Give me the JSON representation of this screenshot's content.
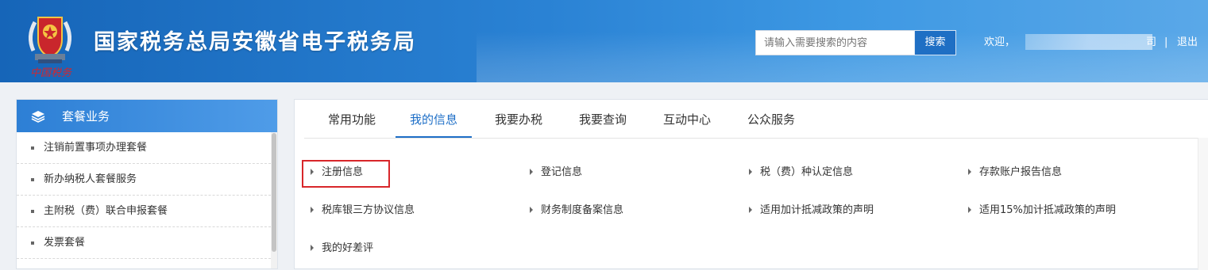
{
  "header": {
    "site_title": "国家税务总局安徽省电子税务局",
    "logo_text": "中国税务",
    "search_placeholder": "请输入需要搜索的内容",
    "search_button": "搜索",
    "welcome": "欢迎，",
    "company_tail": "司",
    "separator": "|",
    "logout": "退出"
  },
  "sidebar": {
    "title": "套餐业务",
    "items": [
      {
        "label": "注销前置事项办理套餐"
      },
      {
        "label": "新办纳税人套餐服务"
      },
      {
        "label": "主附税（费）联合申报套餐"
      },
      {
        "label": "发票套餐"
      }
    ]
  },
  "tabs": [
    {
      "label": "常用功能",
      "active": false
    },
    {
      "label": "我的信息",
      "active": true
    },
    {
      "label": "我要办税",
      "active": false
    },
    {
      "label": "我要查询",
      "active": false
    },
    {
      "label": "互动中心",
      "active": false
    },
    {
      "label": "公众服务",
      "active": false
    }
  ],
  "info_links": [
    {
      "label": "注册信息"
    },
    {
      "label": "登记信息"
    },
    {
      "label": "税（费）种认定信息"
    },
    {
      "label": "存款账户报告信息"
    },
    {
      "label": "税库银三方协议信息"
    },
    {
      "label": "财务制度备案信息"
    },
    {
      "label": "适用加计抵减政策的声明"
    },
    {
      "label": "适用15%加计抵减政策的声明"
    },
    {
      "label": "我的好差评"
    }
  ],
  "colors": {
    "header_blue": "#1665b8",
    "accent": "#1e6fc7",
    "highlight_red": "#d8262a"
  }
}
